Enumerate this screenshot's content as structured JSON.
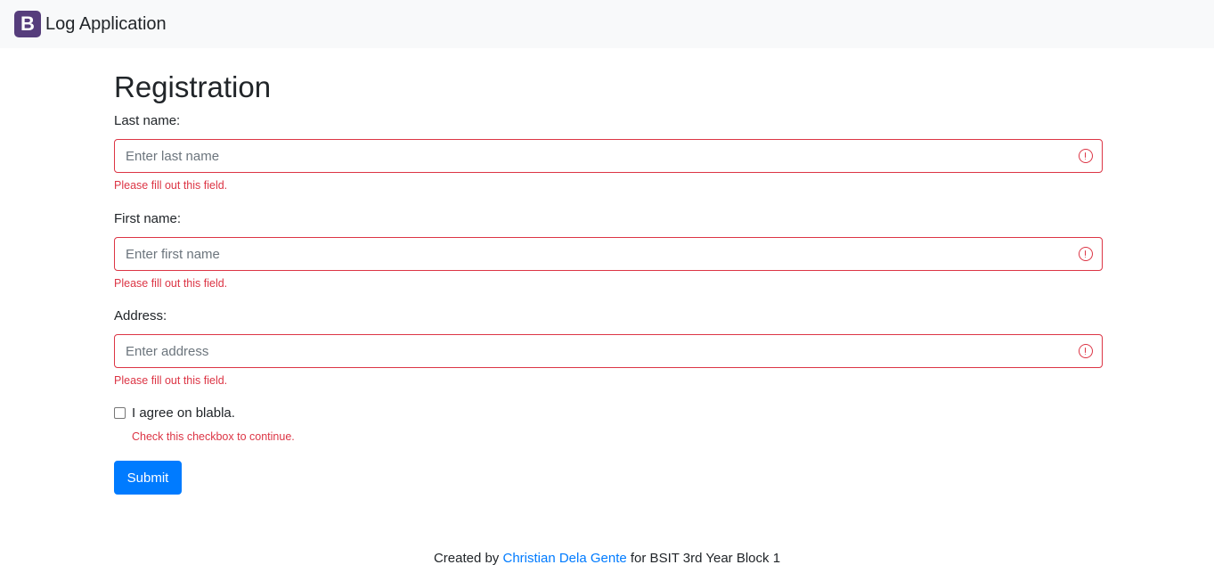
{
  "navbar": {
    "logo_letter": "B",
    "brand": "Log Application"
  },
  "form": {
    "title": "Registration",
    "fields": [
      {
        "label": "Last name:",
        "placeholder": "Enter last name",
        "value": "",
        "feedback": "Please fill out this field."
      },
      {
        "label": "First name:",
        "placeholder": "Enter first name",
        "value": "",
        "feedback": "Please fill out this field."
      },
      {
        "label": "Address:",
        "placeholder": "Enter address",
        "value": "",
        "feedback": "Please fill out this field."
      }
    ],
    "checkbox": {
      "label": "I agree on blabla.",
      "checked": false,
      "feedback": "Check this checkbox to continue."
    },
    "submit_label": "Submit"
  },
  "footer": {
    "prefix": "Created by ",
    "author": "Christian Dela Gente",
    "suffix": " for BSIT 3rd Year Block 1"
  },
  "colors": {
    "brand_logo_bg": "#563d7c",
    "invalid": "#dc3545",
    "primary": "#007bff",
    "navbar_bg": "#f8f9fa"
  }
}
